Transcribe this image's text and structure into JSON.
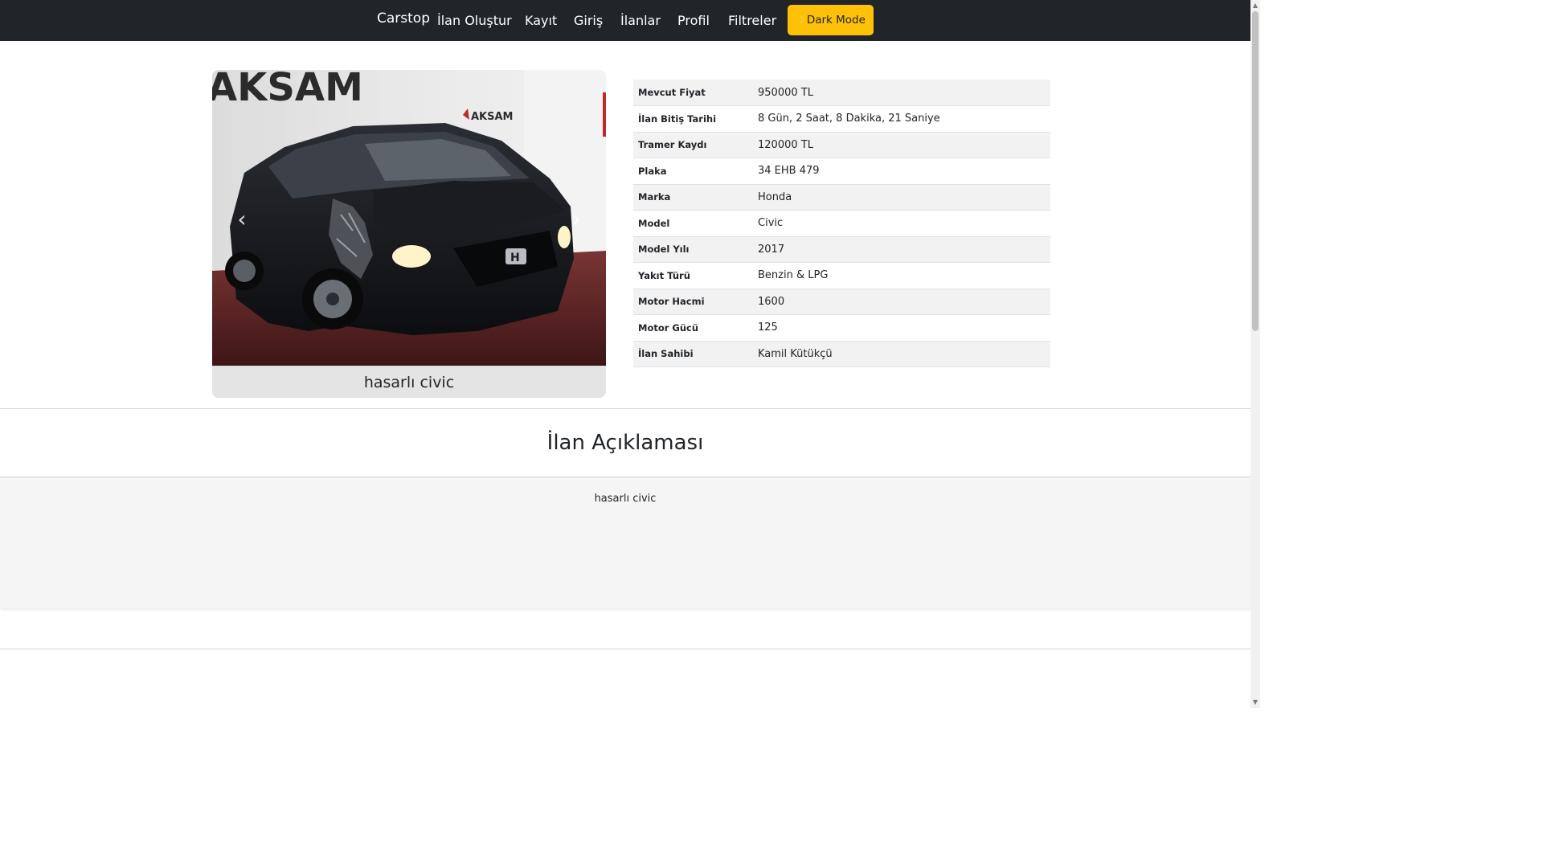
{
  "navbar": {
    "brand": "Carstop",
    "links": [
      "İlan Oluştur",
      "Kayıt",
      "Giriş",
      "İlanlar",
      "Profil",
      "Filtreler"
    ],
    "dark_mode_label": "Dark Mode",
    "dark_mode_icon": "moon-icon"
  },
  "listing": {
    "photo": {
      "banner_text": "AKSAM",
      "logo_text": "AKSAM",
      "badge_text": "H"
    },
    "title": "hasarlı civic",
    "details": [
      {
        "label": "Mevcut Fiyat",
        "value": "950000 TL"
      },
      {
        "label": "İlan Bitiş Tarihi",
        "value": "8 Gün, 2 Saat, 8 Dakika, 21 Saniye"
      },
      {
        "label": "Tramer Kaydı",
        "value": "120000 TL"
      },
      {
        "label": "Plaka",
        "value": "34 EHB 479"
      },
      {
        "label": "Marka",
        "value": "Honda"
      },
      {
        "label": "Model",
        "value": "Civic"
      },
      {
        "label": "Model Yılı",
        "value": "2017"
      },
      {
        "label": "Yakıt Türü",
        "value": "Benzin & LPG"
      },
      {
        "label": "Motor Hacmi",
        "value": "1600"
      },
      {
        "label": "Motor Gücü",
        "value": "125"
      },
      {
        "label": "İlan Sahibi",
        "value": "Kamil Kütükçü"
      }
    ]
  },
  "description": {
    "heading": "İlan Açıklaması",
    "text": "hasarlı civic"
  },
  "colors": {
    "navbar_bg": "#212529",
    "button_warning": "#ffc107"
  }
}
